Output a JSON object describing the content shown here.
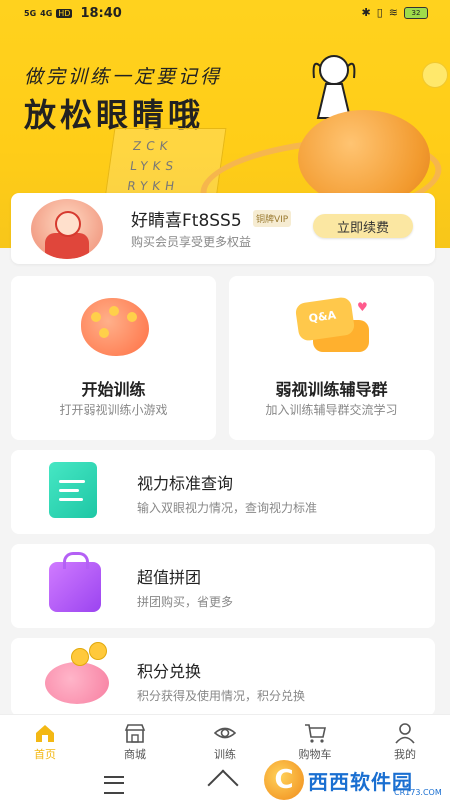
{
  "status_bar": {
    "time": "18:40",
    "signal_1": "5G",
    "signal_2": "4G",
    "hd": "HD",
    "battery": "32"
  },
  "hero": {
    "subtitle": "做完训练一定要记得",
    "title": "放松眼睛哦",
    "chart_letters": [
      "ZCK",
      "LYKS",
      "RYKH"
    ]
  },
  "member": {
    "name": "好睛喜Ft8SS5",
    "vip_badge": "铜牌VIP",
    "desc": "购买会员享受更多权益",
    "renew_label": "立即续费"
  },
  "tiles": [
    {
      "title": "开始训练",
      "subtitle": "打开弱视训练小游戏"
    },
    {
      "title": "弱视训练辅导群",
      "subtitle": "加入训练辅导群交流学习",
      "icon_text": "Q&A"
    }
  ],
  "rows": [
    {
      "title": "视力标准查询",
      "subtitle": "输入双眼视力情况，查询视力标准"
    },
    {
      "title": "超值拼团",
      "subtitle": "拼团购买，省更多"
    },
    {
      "title": "积分兑换",
      "subtitle": "积分获得及使用情况，积分兑换"
    }
  ],
  "tabbar": [
    {
      "label": "首页",
      "icon": "home-icon",
      "active": true
    },
    {
      "label": "商城",
      "icon": "store-icon"
    },
    {
      "label": "训练",
      "icon": "eye-icon"
    },
    {
      "label": "购物车",
      "icon": "cart-icon"
    },
    {
      "label": "我的",
      "icon": "user-icon"
    }
  ],
  "watermark": {
    "brand": "西西软件园",
    "url": "CR173.COM"
  },
  "colors": {
    "accent": "#ffd21e",
    "active_tab": "#f3b814"
  }
}
